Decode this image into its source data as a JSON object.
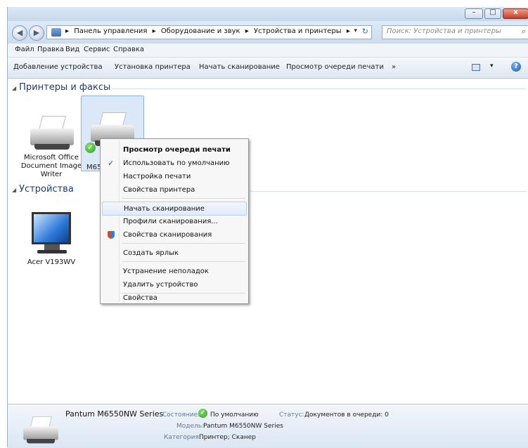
{
  "window": {
    "min_glyph": "–",
    "max_glyph": "□",
    "close_glyph": "x"
  },
  "address": {
    "back_glyph": "◀",
    "forward_glyph": "▶",
    "breadcrumbs": [
      "▸",
      "Панель управления",
      "▸",
      "Оборудование и звук",
      "▸",
      "Устройства и принтеры",
      "▸"
    ],
    "dropdown_glyph": "▾",
    "refresh_glyph": "↻",
    "search_placeholder": "Поиск: Устройства и принтеры",
    "search_glyph": "⌕"
  },
  "menu": [
    "Файл",
    "Правка",
    "Вид",
    "Сервис",
    "Справка"
  ],
  "toolbar": {
    "items": [
      "Добавление устройства",
      "Установка принтера",
      "Начать сканирование",
      "Просмотр очереди печати",
      "»"
    ],
    "view_dd": "▾",
    "help": "?"
  },
  "groups": {
    "printers": {
      "tri": "◢",
      "label": "Принтеры и факсы"
    },
    "devices": {
      "tri": "◢",
      "label": "Устройства"
    }
  },
  "devices": {
    "ms_writer": [
      "Microsoft Office",
      "Document Image",
      "Writer"
    ],
    "pantum_short": "M65",
    "acer": "Acer V193WV"
  },
  "context_menu": {
    "items": [
      "Просмотр очереди печати",
      "Использовать по умолчанию",
      "Настройка печати",
      "Свойства принтера",
      "Начать сканирование",
      "Профили сканирования...",
      "Свойства сканирования",
      "Создать ярлык",
      "Устранение неполадок",
      "Удалить устройство",
      "Свойства"
    ],
    "check_glyph": "✓"
  },
  "details": {
    "name": "Pantum M6550NW Series",
    "state_label": "Состояние:",
    "state_value": "По умолчанию",
    "status_label": "Статус:",
    "status_value": "Документов в очереди: 0",
    "model_label": "Модель:",
    "model_value": "Pantum M6550NW Series",
    "category_label": "Категория:",
    "category_value": "Принтер; Сканер",
    "check_glyph": "✓"
  },
  "colors": {
    "accent": "#3a7ccc",
    "selection": "#dbe8f8",
    "group_header": "#1e3a6e"
  }
}
